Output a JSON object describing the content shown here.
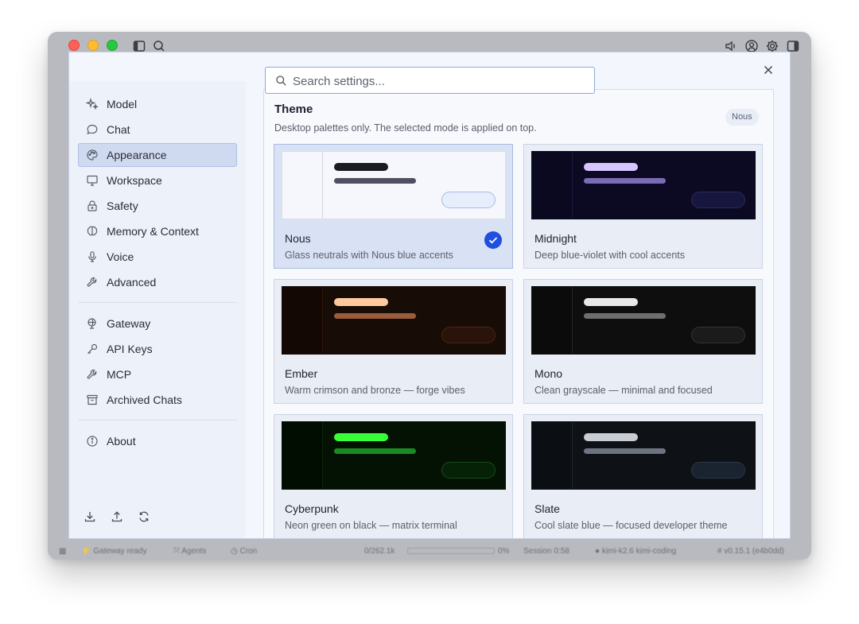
{
  "window": {
    "toolbar_icons": [
      "sidebar-toggle-icon",
      "search-icon",
      "speaker-icon",
      "user-circle-icon",
      "gear-icon",
      "panel-right-icon"
    ]
  },
  "statusbar": {
    "gateway": "Gateway ready",
    "agents": "Agents",
    "cron": "Cron",
    "tokens": "0/262.1k",
    "percent": "0%",
    "session": "Session 0:58",
    "model": "kimi-k2.6 kimi-coding",
    "version": "v0.15.1 (e4b0dd)"
  },
  "dialog": {
    "search_placeholder": "Search settings...",
    "close_label": "Close settings"
  },
  "sidebar": {
    "items": [
      {
        "label": "Model",
        "icon": "sparkles-icon"
      },
      {
        "label": "Chat",
        "icon": "chat-bubble-icon"
      },
      {
        "label": "Appearance",
        "icon": "palette-icon",
        "active": true
      },
      {
        "label": "Workspace",
        "icon": "monitor-icon"
      },
      {
        "label": "Safety",
        "icon": "lock-icon"
      },
      {
        "label": "Memory & Context",
        "icon": "brain-icon"
      },
      {
        "label": "Voice",
        "icon": "microphone-icon"
      },
      {
        "label": "Advanced",
        "icon": "wrench-icon"
      },
      {
        "label": "Gateway",
        "icon": "globe-icon"
      },
      {
        "label": "API Keys",
        "icon": "key-icon"
      },
      {
        "label": "MCP",
        "icon": "plug-icon"
      },
      {
        "label": "Archived Chats",
        "icon": "archive-icon"
      },
      {
        "label": "About",
        "icon": "info-icon"
      }
    ],
    "footer_icons": [
      "download-icon",
      "upload-icon",
      "refresh-icon"
    ]
  },
  "theme_section": {
    "title": "Theme",
    "description": "Desktop palettes only. The selected mode is applied on top.",
    "badge": "Nous",
    "themes": [
      {
        "name": "Nous",
        "description": "Glass neutrals with Nous blue accents",
        "selected": true,
        "colors": {
          "bg": "#f5f7fc",
          "side": "#f5f7fc",
          "divider": "#d0d6e4",
          "bar1": "#1a1a1f",
          "bar2": "#4e5060",
          "pill_bg": "#e6eefb",
          "pill_border": "#a9bbe0"
        }
      },
      {
        "name": "Midnight",
        "description": "Deep blue-violet with cool accents",
        "selected": false,
        "colors": {
          "bg": "#0b0a22",
          "side": "#0a0920",
          "divider": "#1c1b3a",
          "bar1": "#d6c6ff",
          "bar2": "#7a6bb4",
          "pill_bg": "#16163f",
          "pill_border": "#2a2a5a"
        }
      },
      {
        "name": "Ember",
        "description": "Warm crimson and bronze — forge vibes",
        "selected": false,
        "colors": {
          "bg": "#180c06",
          "side": "#130803",
          "divider": "#2a1609",
          "bar1": "#ffc9a0",
          "bar2": "#9b5c3b",
          "pill_bg": "#2a130a",
          "pill_border": "#4a2414"
        }
      },
      {
        "name": "Mono",
        "description": "Clean grayscale — minimal and focused",
        "selected": false,
        "colors": {
          "bg": "#0e0e0e",
          "side": "#0b0b0b",
          "divider": "#242424",
          "bar1": "#e8e8e8",
          "bar2": "#6e6e6e",
          "pill_bg": "#1b1b1b",
          "pill_border": "#333333"
        }
      },
      {
        "name": "Cyberpunk",
        "description": "Neon green on black — matrix terminal",
        "selected": false,
        "colors": {
          "bg": "#031203",
          "side": "#020d02",
          "divider": "#0b260b",
          "bar1": "#38ff38",
          "bar2": "#1c8a24",
          "pill_bg": "#062206",
          "pill_border": "#1a4a1a"
        }
      },
      {
        "name": "Slate",
        "description": "Cool slate blue — focused developer theme",
        "selected": false,
        "colors": {
          "bg": "#0e1217",
          "side": "#0b0f14",
          "divider": "#1f262e",
          "bar1": "#c8ccd3",
          "bar2": "#6d7480",
          "pill_bg": "#1a2330",
          "pill_border": "#2c3748"
        }
      }
    ]
  }
}
